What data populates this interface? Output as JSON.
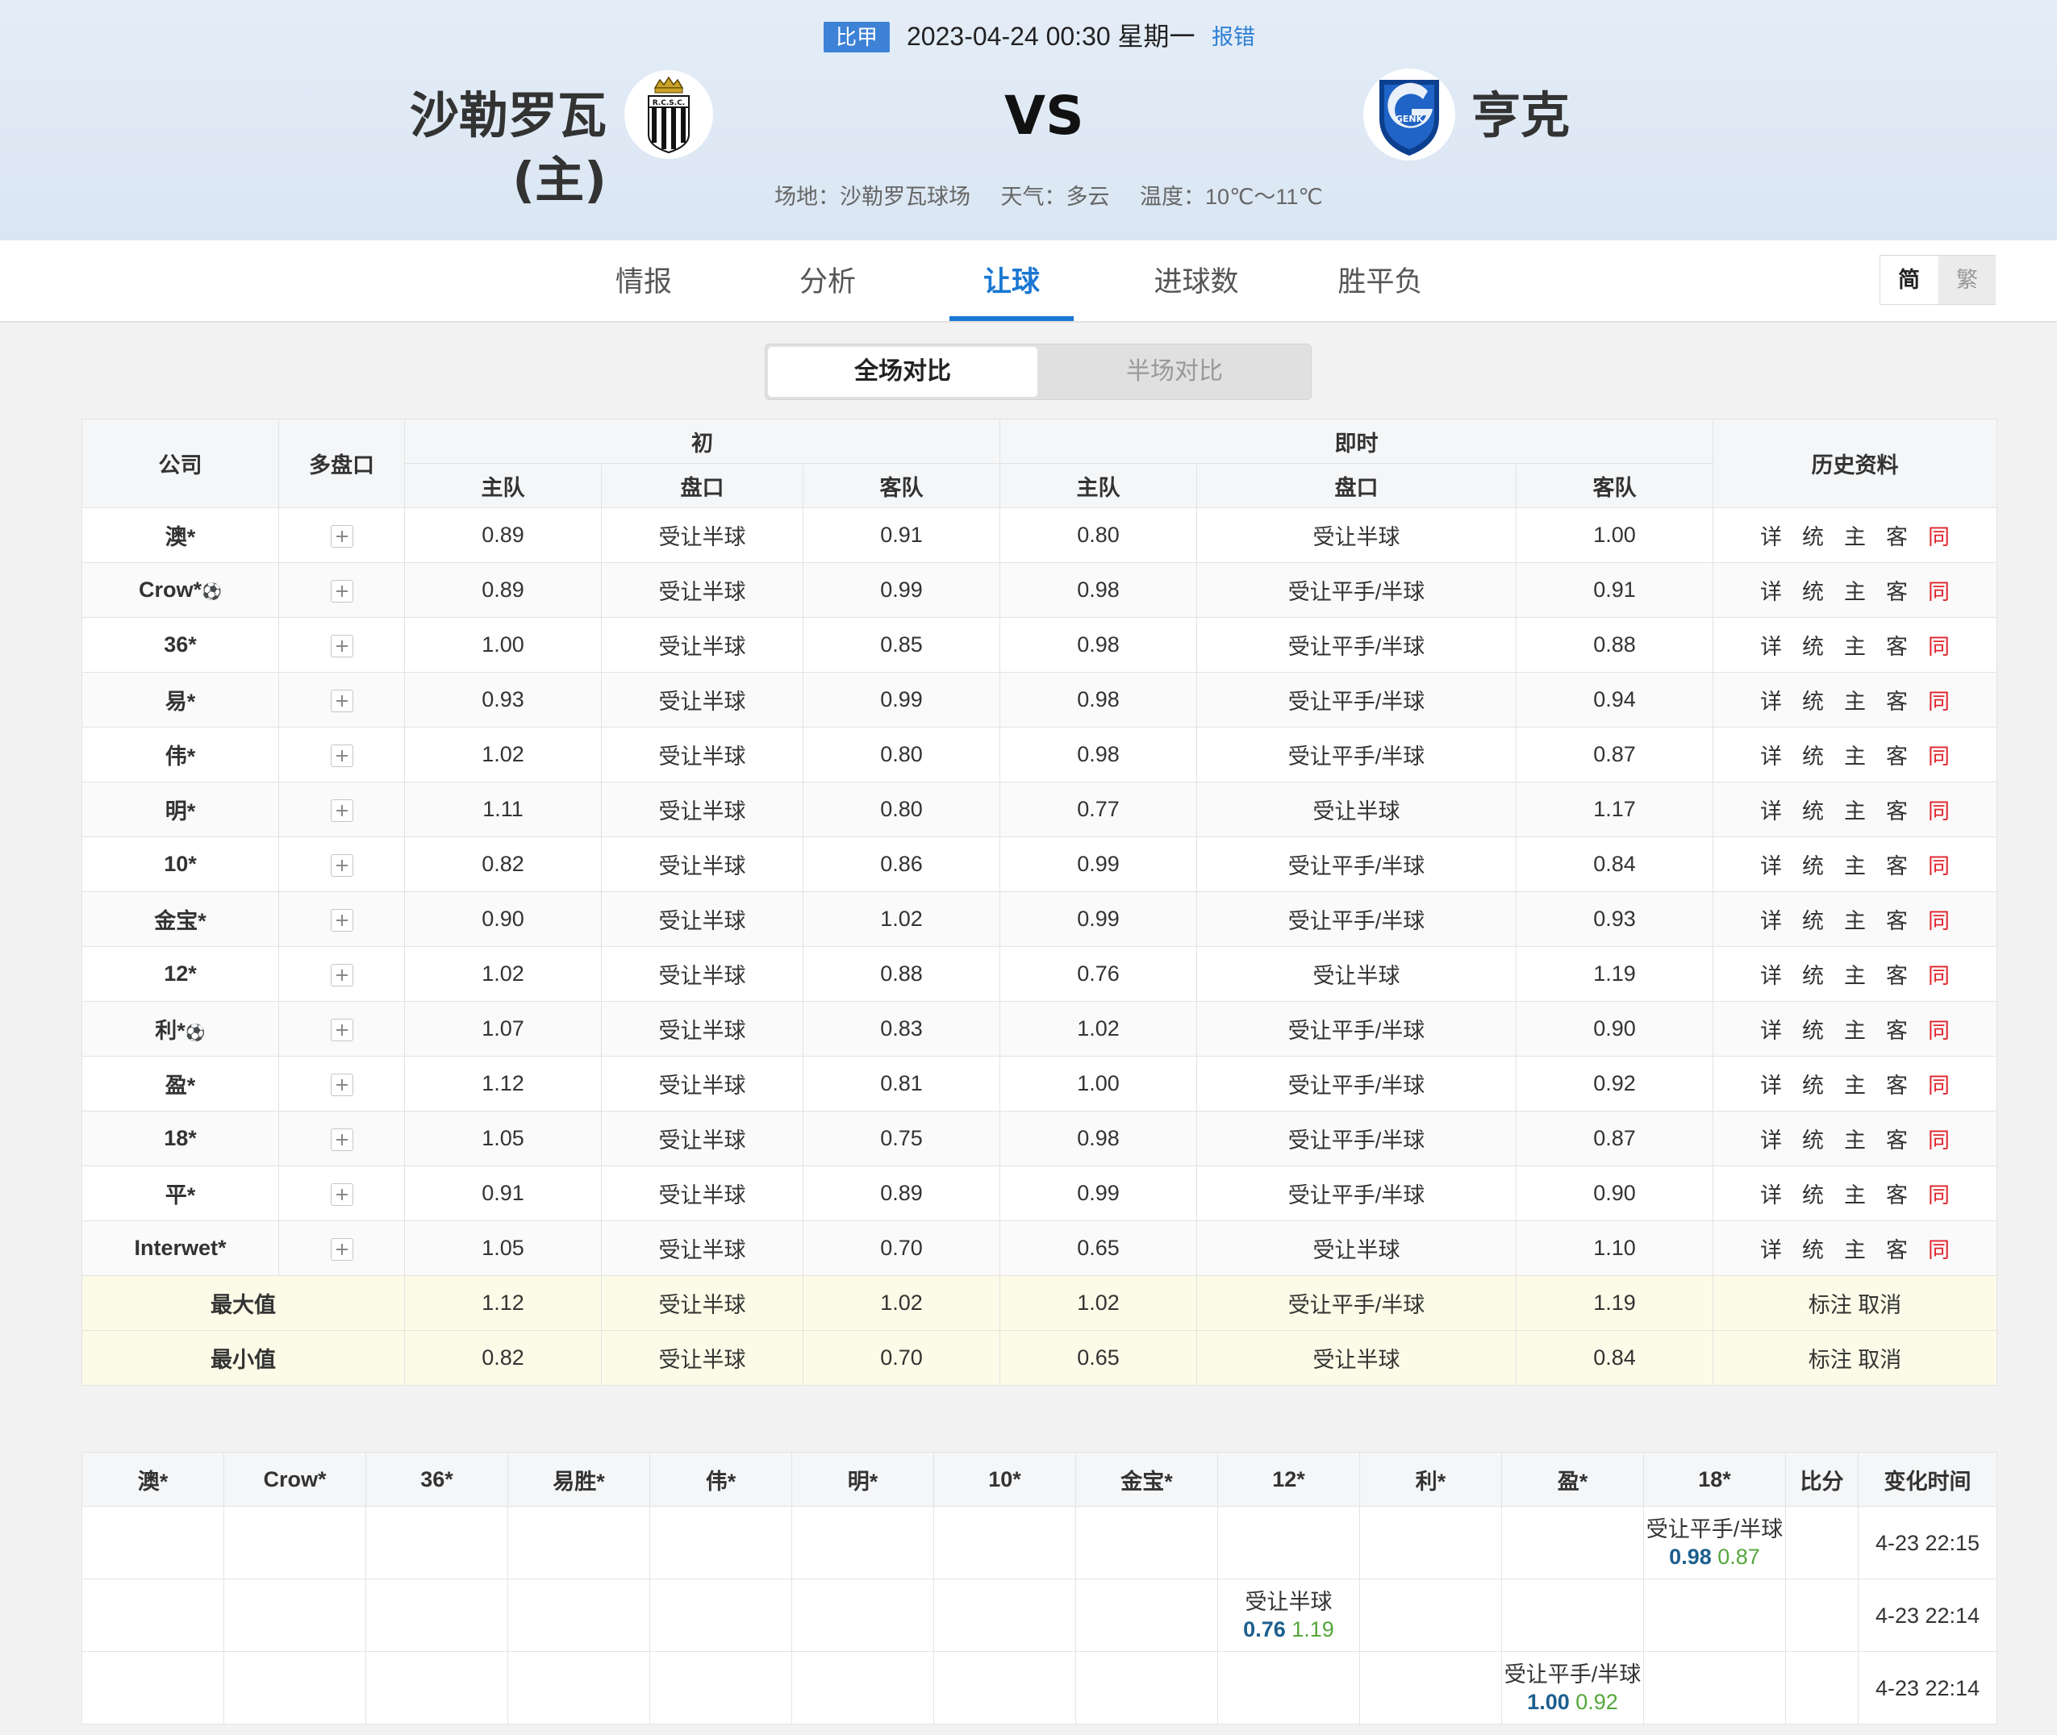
{
  "header": {
    "league": "比甲",
    "datetime": "2023-04-24 00:30 星期一",
    "report": "报错",
    "home_team": "沙勒罗瓦 (主)",
    "vs": "VS",
    "away_team": "亨克",
    "home_logo_text": "R.C.S.C.",
    "away_logo_text": "GENK",
    "venue": "场地：沙勒罗瓦球场",
    "weather": "天气：多云",
    "temperature": "温度：10℃～11℃"
  },
  "tabs": [
    "情报",
    "分析",
    "让球",
    "进球数",
    "胜平负"
  ],
  "active_tab": "让球",
  "lang": {
    "simplified": "简",
    "traditional": "繁"
  },
  "segment": {
    "full": "全场对比",
    "half": "半场对比"
  },
  "table": {
    "headers": {
      "company": "公司",
      "multi": "多盘口",
      "initial": "初",
      "live": "即时",
      "history": "历史资料",
      "home": "主队",
      "line": "盘口",
      "away": "客队"
    },
    "links": [
      "详",
      "统",
      "主",
      "客",
      "同"
    ],
    "rows": [
      {
        "company": "澳*",
        "ball": false,
        "init": [
          "0.89",
          "受让半球",
          "0.91"
        ],
        "live": [
          "0.80",
          "受让半球",
          "1.00"
        ]
      },
      {
        "company": "Crow*",
        "ball": true,
        "init": [
          "0.89",
          "受让半球",
          "0.99"
        ],
        "live": [
          "0.98",
          "受让平手/半球",
          "0.91"
        ]
      },
      {
        "company": "36*",
        "ball": false,
        "init": [
          "1.00",
          "受让半球",
          "0.85"
        ],
        "live": [
          "0.98",
          "受让平手/半球",
          "0.88"
        ]
      },
      {
        "company": "易*",
        "ball": false,
        "init": [
          "0.93",
          "受让半球",
          "0.99"
        ],
        "live": [
          "0.98",
          "受让平手/半球",
          "0.94"
        ]
      },
      {
        "company": "伟*",
        "ball": false,
        "init": [
          "1.02",
          "受让半球",
          "0.80"
        ],
        "live": [
          "0.98",
          "受让平手/半球",
          "0.87"
        ]
      },
      {
        "company": "明*",
        "ball": false,
        "init": [
          "1.11",
          "受让半球",
          "0.80"
        ],
        "live": [
          "0.77",
          "受让半球",
          "1.17"
        ]
      },
      {
        "company": "10*",
        "ball": false,
        "init": [
          "0.82",
          "受让半球",
          "0.86"
        ],
        "live": [
          "0.99",
          "受让平手/半球",
          "0.84"
        ]
      },
      {
        "company": "金宝*",
        "ball": false,
        "init": [
          "0.90",
          "受让半球",
          "1.02"
        ],
        "live": [
          "0.99",
          "受让平手/半球",
          "0.93"
        ]
      },
      {
        "company": "12*",
        "ball": false,
        "init": [
          "1.02",
          "受让半球",
          "0.88"
        ],
        "live": [
          "0.76",
          "受让半球",
          "1.19"
        ]
      },
      {
        "company": "利*",
        "ball": true,
        "init": [
          "1.07",
          "受让半球",
          "0.83"
        ],
        "live": [
          "1.02",
          "受让平手/半球",
          "0.90"
        ]
      },
      {
        "company": "盈*",
        "ball": false,
        "init": [
          "1.12",
          "受让半球",
          "0.81"
        ],
        "live": [
          "1.00",
          "受让平手/半球",
          "0.92"
        ]
      },
      {
        "company": "18*",
        "ball": false,
        "init": [
          "1.05",
          "受让半球",
          "0.75"
        ],
        "live": [
          "0.98",
          "受让平手/半球",
          "0.87"
        ]
      },
      {
        "company": "平*",
        "ball": false,
        "init": [
          "0.91",
          "受让半球",
          "0.89"
        ],
        "live": [
          "0.99",
          "受让平手/半球",
          "0.90"
        ]
      },
      {
        "company": "Interwet*",
        "ball": false,
        "init": [
          "1.05",
          "受让半球",
          "0.70"
        ],
        "live": [
          "0.65",
          "受让半球",
          "1.10"
        ]
      }
    ],
    "summary": [
      {
        "label": "最大值",
        "init": [
          "1.12",
          "受让半球",
          "1.02"
        ],
        "live": [
          "1.02",
          "受让平手/半球",
          "1.19"
        ],
        "action": "标注 取消"
      },
      {
        "label": "最小值",
        "init": [
          "0.82",
          "受让半球",
          "0.70"
        ],
        "live": [
          "0.65",
          "受让半球",
          "0.84"
        ],
        "action": "标注 取消"
      }
    ]
  },
  "history": {
    "headers": [
      "澳*",
      "Crow*",
      "36*",
      "易胜*",
      "伟*",
      "明*",
      "10*",
      "金宝*",
      "12*",
      "利*",
      "盈*",
      "18*",
      "比分",
      "变化时间"
    ],
    "rows": [
      {
        "col": 11,
        "line": "受让平手/半球",
        "home": "0.98",
        "away": "0.87",
        "time": "4-23 22:15"
      },
      {
        "col": 8,
        "line": "受让半球",
        "home": "0.76",
        "away": "1.19",
        "time": "4-23 22:14"
      },
      {
        "col": 10,
        "line": "受让平手/半球",
        "home": "1.00",
        "away": "0.92",
        "time": "4-23 22:14"
      }
    ]
  },
  "colors": {
    "accent": "#1a77d2",
    "league_badge": "#3d82d6",
    "link_red": "#e0242b",
    "summary_bg": "#fbfbe7",
    "odds_blue": "#1c5f8e",
    "odds_green": "#55a63c"
  }
}
